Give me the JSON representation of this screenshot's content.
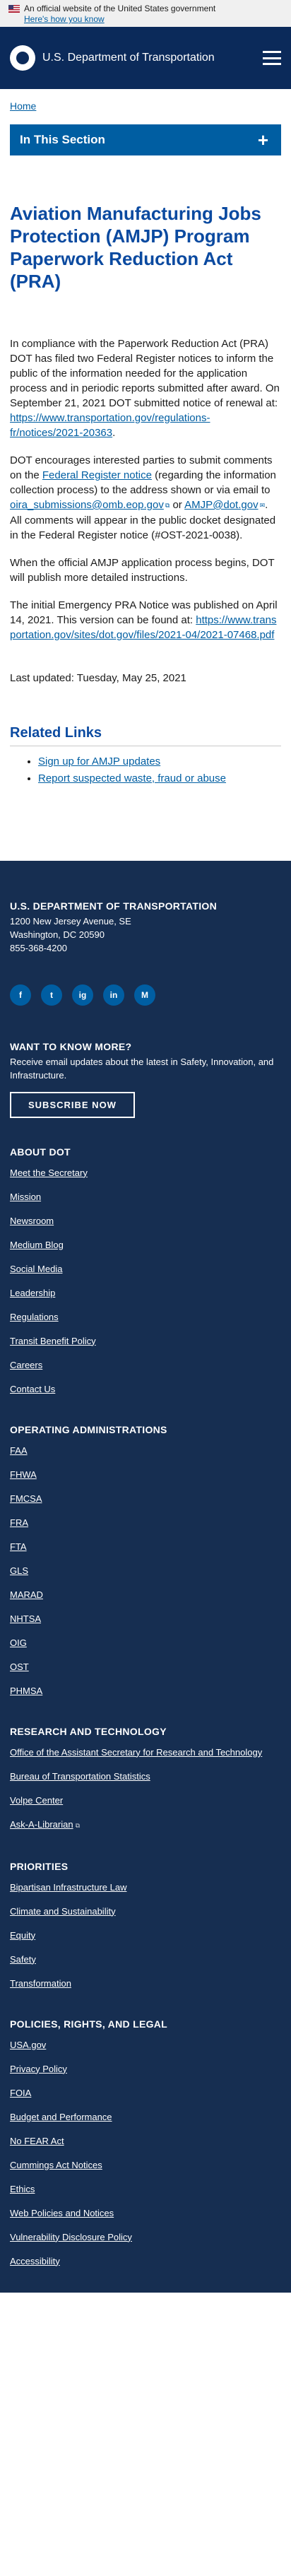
{
  "banner": {
    "official": "An official website of the United States government",
    "how_link": "Here's how you know"
  },
  "header": {
    "site_title": "U.S. Department of Transportation"
  },
  "breadcrumb": {
    "home": "Home"
  },
  "section_nav": {
    "title": "In This Section"
  },
  "page": {
    "title": "Aviation Manufacturing Jobs Protection (AMJP) Program Paperwork Reduction Act (PRA)",
    "p1_text": "In compliance with the Paperwork Reduction Act (PRA) DOT has filed two Federal Register notices to inform the public of the information needed for the application process and in periodic reports submitted after award. On September 21, 2021 DOT submitted notice of renewal at: ",
    "p1_link": "https://www.transportation.gov/regulations-fr/notices/2021-20363",
    "p2_a": "DOT encourages interested parties to submit comments on the ",
    "p2_link1": "Federal Register notice",
    "p2_b": " (regarding the information collection process) to the address shown or via email to ",
    "p2_link2": "oira_submissions@omb.eop.gov",
    "p2_c": " or ",
    "p2_link3": "AMJP@dot.gov",
    "p2_d": ". All comments will appear in the public docket designated in the Federal Register notice (#OST-2021-0038).",
    "p3": "When the official AMJP application process begins, DOT will publish more detailed instructions.",
    "p4_text": "The initial Emergency PRA Notice was published on April 14, 2021. This version can be found at: ",
    "p4_link": "https://www.transportation.gov/sites/dot.gov/files/2021-04/2021-07468.pdf",
    "last_updated": "Last updated: Tuesday, May 25, 2021"
  },
  "related": {
    "title": "Related Links",
    "links": [
      "Sign up for AMJP updates",
      "Report suspected waste, fraud or abuse"
    ]
  },
  "footer": {
    "org": "U.S. DEPARTMENT OF TRANSPORTATION",
    "addr1": "1200 New Jersey Avenue, SE",
    "addr2": "Washington, DC 20590",
    "phone": "855-368-4200",
    "social": [
      "f",
      "t",
      "ig",
      "in",
      "M"
    ],
    "know_title": "WANT TO KNOW MORE?",
    "know_text": "Receive email updates about the latest in Safety, Innovation, and Infrastructure.",
    "subscribe": "SUBSCRIBE NOW",
    "about": {
      "title": "ABOUT DOT",
      "items": [
        "Meet the Secretary",
        "Mission",
        "Newsroom",
        "Medium Blog",
        "Social Media",
        "Leadership",
        "Regulations",
        "Transit Benefit Policy",
        "Careers",
        "Contact Us"
      ]
    },
    "ops": {
      "title": "OPERATING ADMINISTRATIONS",
      "items": [
        "FAA",
        "FHWA",
        "FMCSA",
        "FRA",
        "FTA",
        "GLS",
        "MARAD",
        "NHTSA",
        "OIG",
        "OST",
        "PHMSA"
      ]
    },
    "research": {
      "title": "RESEARCH AND TECHNOLOGY",
      "items": [
        "Office of the Assistant Secretary for Research and Technology",
        "Bureau of Transportation Statistics",
        "Volpe Center",
        "Ask-A-Librarian"
      ]
    },
    "priorities": {
      "title": "PRIORITIES",
      "items": [
        "Bipartisan Infrastructure Law",
        "Climate and Sustainability",
        "Equity",
        "Safety",
        "Transformation"
      ]
    },
    "policies": {
      "title": "POLICIES, RIGHTS, AND LEGAL",
      "items": [
        "USA.gov",
        "Privacy Policy",
        "FOIA",
        "Budget and Performance",
        "No FEAR Act",
        "Cummings Act Notices",
        "Ethics",
        "Web Policies and Notices",
        "Vulnerability Disclosure Policy",
        "Accessibility"
      ]
    }
  }
}
